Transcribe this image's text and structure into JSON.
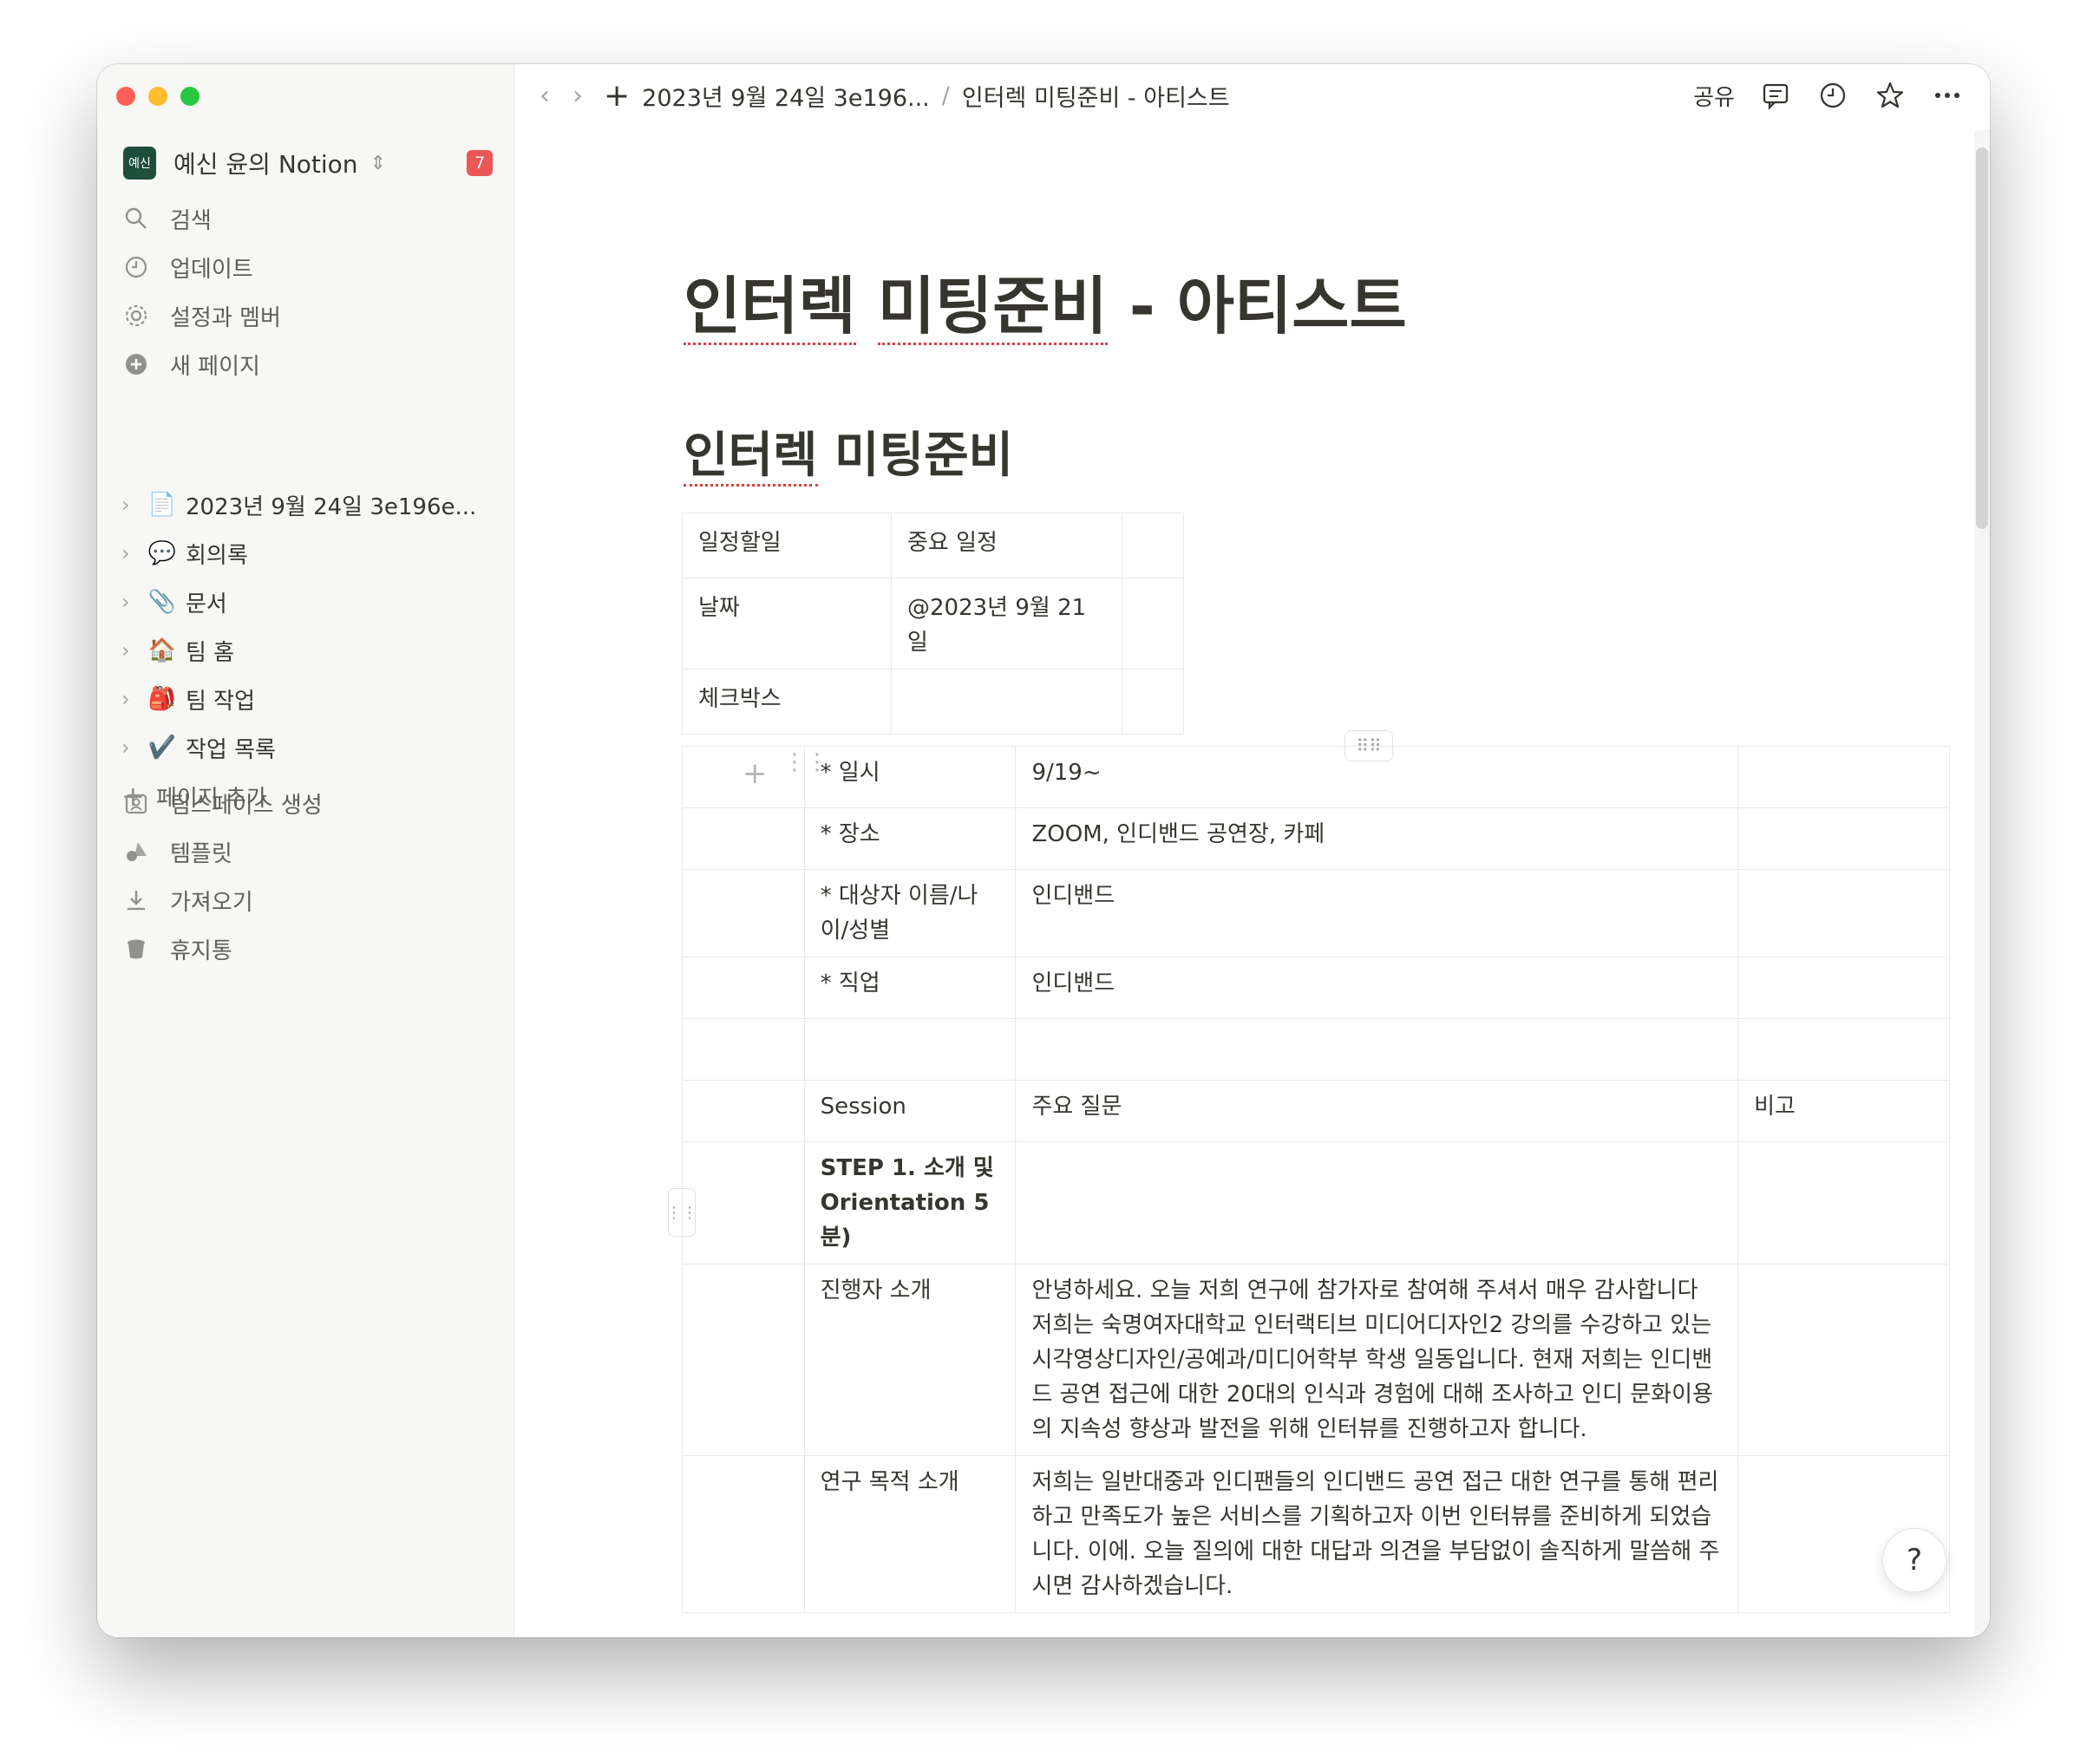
{
  "workspace": {
    "logo": "예신",
    "name": "예신 윤의 Notion",
    "badge": "7"
  },
  "nav": [
    {
      "label": "검색",
      "icon": "search-icon"
    },
    {
      "label": "업데이트",
      "icon": "clock-icon"
    },
    {
      "label": "설정과 멤버",
      "icon": "gear-icon"
    },
    {
      "label": "새 페이지",
      "icon": "plus-circle-icon"
    }
  ],
  "pages": [
    {
      "emoji": "📄",
      "label": "2023년 9월 24일 3e196e..."
    },
    {
      "emoji": "💬",
      "label": "회의록"
    },
    {
      "emoji": "📎",
      "label": "문서"
    },
    {
      "emoji": "🏠",
      "label": "팀 홈"
    },
    {
      "emoji": "🎒",
      "label": "팀 작업"
    },
    {
      "emoji": "✔️",
      "label": "작업 목록"
    }
  ],
  "add_page": "페이지 추가",
  "tools": [
    {
      "label": "팀스페이스 생성",
      "icon": "teamspace-icon"
    },
    {
      "label": "템플릿",
      "icon": "shapes-icon"
    },
    {
      "label": "가져오기",
      "icon": "download-icon"
    },
    {
      "label": "휴지통",
      "icon": "trash-icon"
    }
  ],
  "topbar": {
    "breadcrumb_parent": "2023년 9월 24일 3e196...",
    "breadcrumb_sep": "/",
    "breadcrumb_current": "인터렉 미팅준비 - 아티스트",
    "share": "공유"
  },
  "page": {
    "title_a": "인터렉",
    "title_b": "미팅준비",
    "title_c": " - 아티스트",
    "heading_a": "인터렉",
    "heading_b": " 미팅준비"
  },
  "table1": [
    [
      "일정할일",
      "중요 일정",
      ""
    ],
    [
      "날짜",
      "@2023년 9월 21일",
      ""
    ],
    [
      "체크박스",
      "",
      ""
    ]
  ],
  "table2": [
    [
      "",
      "* 일시",
      "9/19~",
      ""
    ],
    [
      "",
      "* 장소",
      "ZOOM, 인디밴드 공연장, 카페",
      ""
    ],
    [
      "",
      "* 대상자 이름/나이/성별",
      "인디밴드",
      ""
    ],
    [
      "",
      "* 직업",
      "인디밴드",
      ""
    ],
    [
      "",
      "",
      "",
      ""
    ],
    [
      "",
      "Session",
      "주요 질문",
      "비고"
    ],
    [
      "",
      "STEP 1. 소개 및 Orientation 5분)",
      "",
      ""
    ],
    [
      "",
      "진행자 소개",
      "안녕하세요. 오늘 저희 연구에 참가자로 참여해 주셔서 매우 감사합니다 저희는 숙명여자대학교 인터랙티브 미디어디자인2 강의를 수강하고 있는 시각영상디자인/공예과/미디어학부 학생 일동입니다. 현재 저희는 인디밴드 공연 접근에 대한 20대의 인식과 경험에 대해 조사하고 인디 문화이용의 지속성 향상과 발전을 위해 인터뷰를 진행하고자 합니다.",
      ""
    ],
    [
      "",
      "연구 목적 소개",
      "저희는 일반대중과 인디팬들의 인디밴드 공연 접근 대한 연구를 통해 편리하고 만족도가 높은 서비스를 기획하고자 이번 인터뷰를 준비하게 되었습니다. 이에. 오늘 질의에 대한 대답과 의견을 부담없이 솔직하게 말씀해 주시면 감사하겠습니다.",
      ""
    ]
  ],
  "help": "?"
}
